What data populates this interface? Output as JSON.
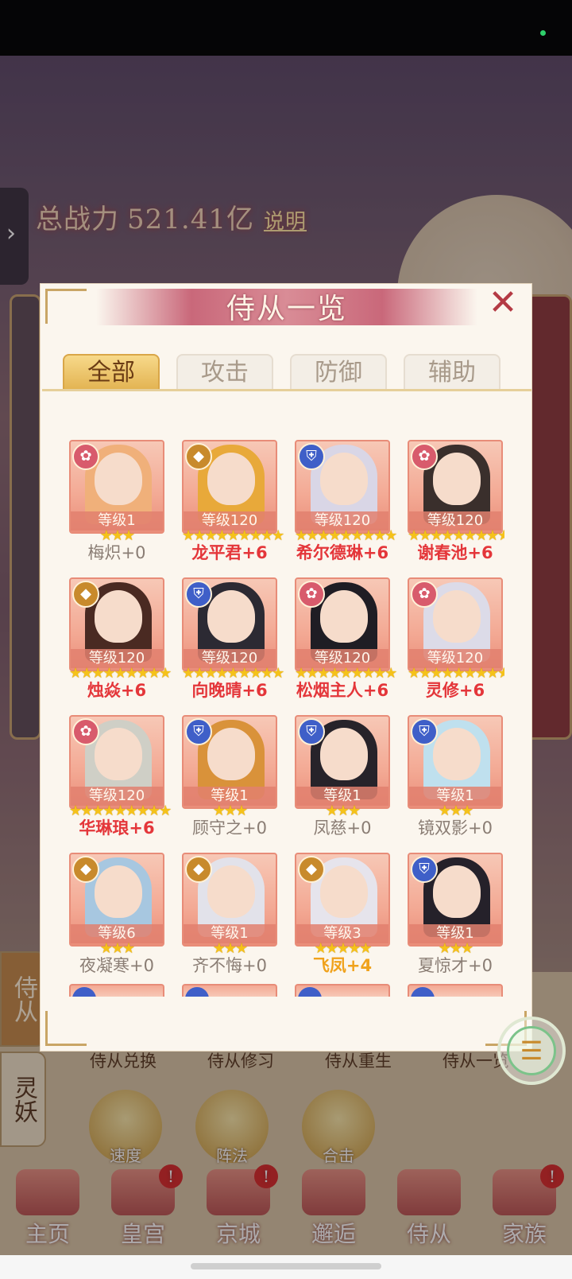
{
  "background": {
    "power_label": "总战力",
    "power_value": "521.41亿",
    "explain_label": "说明",
    "side_tabs": [
      {
        "label": "侍从"
      },
      {
        "label": "灵妖"
      }
    ],
    "bottom_links": [
      "侍从兑换",
      "侍从修习",
      "侍从重生",
      "侍从一览"
    ],
    "round_buttons": [
      {
        "label": "速度"
      },
      {
        "label": "阵法"
      },
      {
        "label": "合击"
      }
    ],
    "nav": [
      {
        "label": "主页",
        "badge": ""
      },
      {
        "label": "皇宫",
        "badge": "!"
      },
      {
        "label": "京城",
        "badge": "!"
      },
      {
        "label": "邂逅",
        "badge": ""
      },
      {
        "label": "侍从",
        "badge": ""
      },
      {
        "label": "家族",
        "badge": "!"
      }
    ]
  },
  "modal": {
    "title": "侍从一览",
    "close_icon": "✕",
    "tabs": [
      {
        "label": "全部",
        "active": true
      },
      {
        "label": "攻击",
        "active": false
      },
      {
        "label": "防御",
        "active": false
      },
      {
        "label": "辅助",
        "active": false
      }
    ],
    "attendants": [
      {
        "name": "梅炽+0",
        "level": "等级1",
        "stars": "★★★",
        "faction": "rose",
        "name_color": "grey",
        "hair": "#f0b07a"
      },
      {
        "name": "龙平君+6",
        "level": "等级120",
        "stars": "★★★★★★★★★",
        "faction": "gold",
        "name_color": "red",
        "hair": "#e8a93a"
      },
      {
        "name": "希尔德琳+6",
        "level": "等级120",
        "stars": "★★★★★★★★★",
        "faction": "shield",
        "name_color": "red",
        "hair": "#d9d6e6"
      },
      {
        "name": "谢春池+6",
        "level": "等级120",
        "stars": "★★★★★★★★★",
        "faction": "rose",
        "name_color": "red",
        "hair": "#3a2f2c"
      },
      {
        "name": "烛焱+6",
        "level": "等级120",
        "stars": "★★★★★★★★★",
        "faction": "gold",
        "name_color": "red",
        "hair": "#4a2a22"
      },
      {
        "name": "向晚晴+6",
        "level": "等级120",
        "stars": "★★★★★★★★★",
        "faction": "shield",
        "name_color": "red",
        "hair": "#2c2a33"
      },
      {
        "name": "松烟主人+6",
        "level": "等级120",
        "stars": "★★★★★★★★★",
        "faction": "rose",
        "name_color": "red",
        "hair": "#1f1d24"
      },
      {
        "name": "灵修+6",
        "level": "等级120",
        "stars": "★★★★★★★★★",
        "faction": "rose",
        "name_color": "red",
        "hair": "#dcdbe8"
      },
      {
        "name": "华琳琅+6",
        "level": "等级120",
        "stars": "★★★★★★★★★",
        "faction": "rose",
        "name_color": "red",
        "hair": "#cfcfc6"
      },
      {
        "name": "顾守之+0",
        "level": "等级1",
        "stars": "★★★",
        "faction": "shield",
        "name_color": "grey",
        "hair": "#d9923a"
      },
      {
        "name": "凤慈+0",
        "level": "等级1",
        "stars": "★★★",
        "faction": "shield",
        "name_color": "grey",
        "hair": "#27232a"
      },
      {
        "name": "镜双影+0",
        "level": "等级1",
        "stars": "★★★",
        "faction": "shield",
        "name_color": "grey",
        "hair": "#bfe0ee"
      },
      {
        "name": "夜凝寒+0",
        "level": "等级6",
        "stars": "★★★",
        "faction": "gold",
        "name_color": "grey",
        "hair": "#a7c7e0"
      },
      {
        "name": "齐不悔+0",
        "level": "等级1",
        "stars": "★★★",
        "faction": "gold",
        "name_color": "grey",
        "hair": "#e2e2ea"
      },
      {
        "name": "飞凤+4",
        "level": "等级3",
        "stars": "★★★★★",
        "faction": "gold",
        "name_color": "gold",
        "hair": "#e6e4ec"
      },
      {
        "name": "夏惊才+0",
        "level": "等级1",
        "stars": "★★★",
        "faction": "shield",
        "name_color": "grey",
        "hair": "#25212a"
      }
    ],
    "menu_icon": "☰"
  }
}
